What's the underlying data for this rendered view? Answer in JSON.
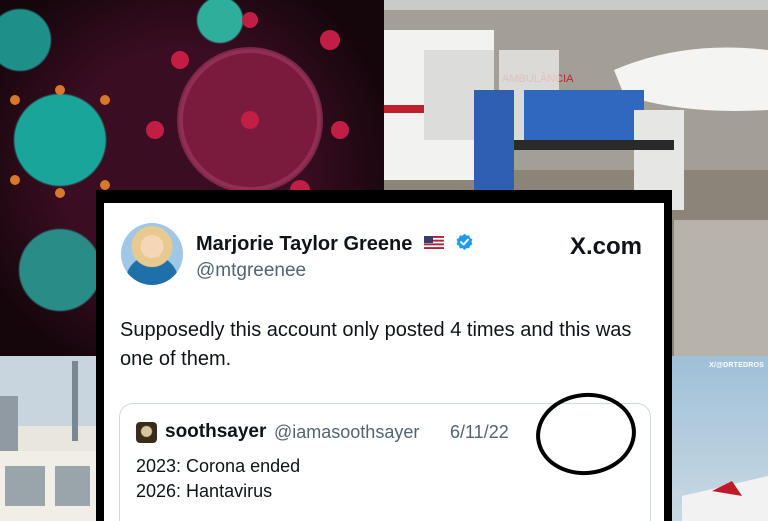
{
  "panels": {
    "top_right": {
      "ambulance_sign": "AMBULÂNCIA"
    },
    "bottom_right": {
      "credit": "X/@DRTEDROS"
    }
  },
  "tweet": {
    "author_name": "Marjorie Taylor Greene",
    "author_handle": "@mtgreenee",
    "flag_icon": "us-flag-icon",
    "verified_icon": "verified-badge-icon",
    "site": "X.com",
    "text": "Supposedly this account only posted 4 times and this was one of them.",
    "quote": {
      "author_name": "soothsayer",
      "author_handle": "@iamasoothsayer",
      "date": "6/11/22",
      "lines": [
        "2023: Corona ended",
        "2026: Hantavirus"
      ]
    }
  },
  "colors": {
    "text_primary": "#0f1419",
    "text_secondary": "#536471",
    "verified_blue": "#1d9bf0"
  }
}
